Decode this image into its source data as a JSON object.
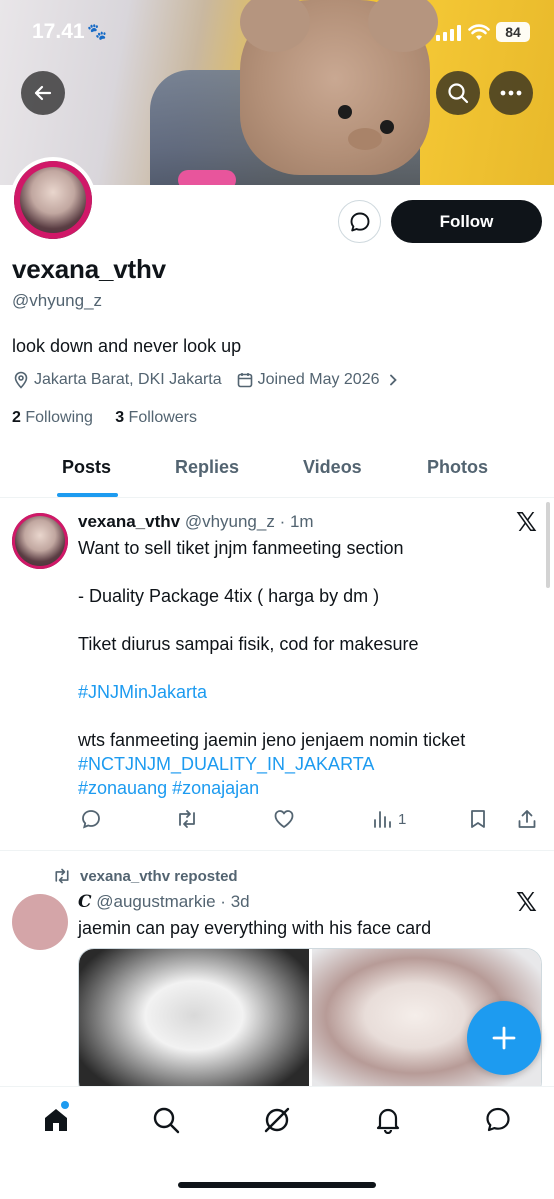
{
  "status_bar": {
    "time": "17.41",
    "battery": "84"
  },
  "profile": {
    "display_name": "vexana_vthv",
    "handle": "@vhyung_z",
    "bio": "look down and never look up",
    "location": "Jakarta Barat, DKI Jakarta",
    "joined": "Joined May 2026",
    "following_count": "2",
    "following_label": "Following",
    "followers_count": "3",
    "followers_label": "Followers",
    "follow_label": "Follow"
  },
  "tabs": [
    {
      "label": "Posts",
      "active": true
    },
    {
      "label": "Replies",
      "active": false
    },
    {
      "label": "Videos",
      "active": false
    },
    {
      "label": "Photos",
      "active": false
    }
  ],
  "tweet1": {
    "name": "vexana_vthv",
    "handle": "@vhyung_z",
    "time": "1m",
    "line1": "Want to sell tiket jnjm fanmeeting section",
    "line2": "- Duality Package 4tix ( harga by dm )",
    "line3": "Tiket diurus sampai fisik, cod for makesure",
    "hashtag1": "#JNJMinJakarta",
    "line4": "wts fanmeeting jaemin jeno jenjaem nomin ticket",
    "hashtag2": "#NCTJNJM_DUALITY_IN_JAKARTA",
    "hashtag3": "#zonauang",
    "hashtag4": "#zonajajan",
    "views": "1"
  },
  "tweet2": {
    "repost_label": "vexana_vthv reposted",
    "name_glyph": "𝑪",
    "handle": "@augustmarkie",
    "time": "3d",
    "text": "jaemin can pay everything with his face card"
  },
  "colors": {
    "accent": "#1d9bf0",
    "text": "#0f1419",
    "muted": "#536471"
  }
}
